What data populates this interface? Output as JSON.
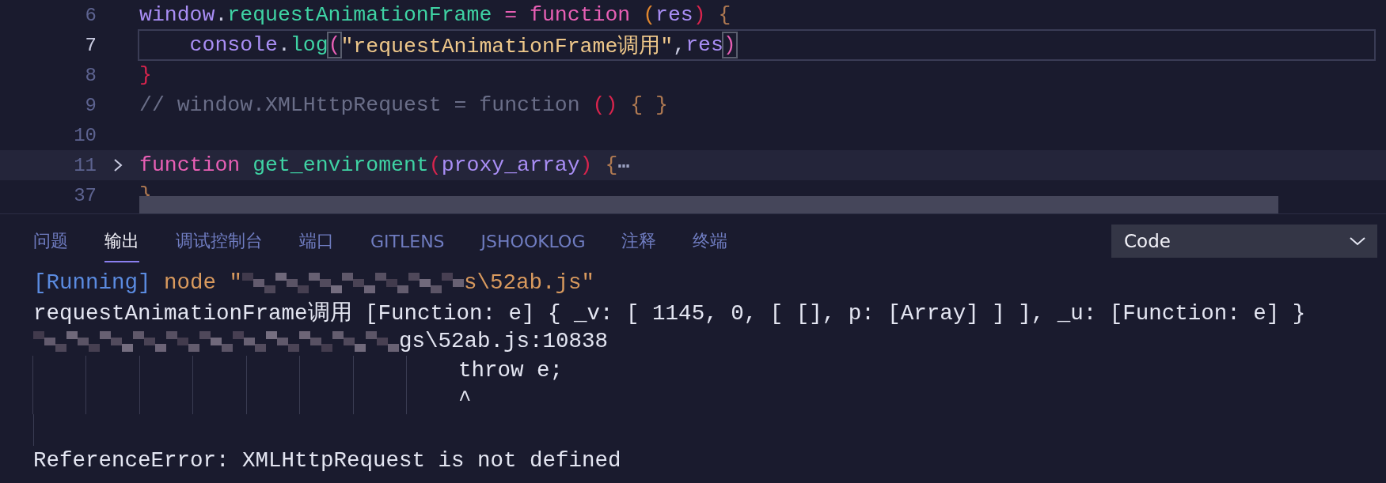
{
  "editor": {
    "lines": [
      {
        "number": "6",
        "current": false,
        "folded": false,
        "tokens": [
          {
            "text": "window",
            "kind": "var"
          },
          {
            "text": ".",
            "kind": "plain"
          },
          {
            "text": "requestAnimationFrame",
            "kind": "prop"
          },
          {
            "text": " = ",
            "kind": "op"
          },
          {
            "text": "function ",
            "kind": "keyword"
          },
          {
            "text": "(",
            "kind": "paren"
          },
          {
            "text": "res",
            "kind": "var"
          },
          {
            "text": ")",
            "kind": "paren2"
          },
          {
            "text": " {",
            "kind": "brace"
          }
        ]
      },
      {
        "number": "7",
        "current": true,
        "folded": false,
        "tokens": [
          {
            "text": "    console",
            "kind": "var"
          },
          {
            "text": ".",
            "kind": "plain"
          },
          {
            "text": "log",
            "kind": "prop"
          },
          {
            "text": "(",
            "kind": "match"
          },
          {
            "text": "\"requestAnimationFrame调用\"",
            "kind": "string"
          },
          {
            "text": ",",
            "kind": "plain"
          },
          {
            "text": "res",
            "kind": "var"
          },
          {
            "text": ")",
            "kind": "match"
          }
        ]
      },
      {
        "number": "8",
        "current": false,
        "folded": false,
        "tokens": [
          {
            "text": "}",
            "kind": "paren2"
          }
        ]
      },
      {
        "number": "9",
        "current": false,
        "folded": false,
        "tokens": [
          {
            "text": "// window.XMLHttpRequest = function ",
            "kind": "comment"
          },
          {
            "text": "()",
            "kind": "paren2"
          },
          {
            "text": " { }",
            "kind": "brace"
          }
        ]
      },
      {
        "number": "10",
        "current": false,
        "folded": false
      },
      {
        "number": "11",
        "current": false,
        "folded": true,
        "tokens": [
          {
            "text": "function ",
            "kind": "keyword"
          },
          {
            "text": "get_enviroment",
            "kind": "prop"
          },
          {
            "text": "(",
            "kind": "paren2"
          },
          {
            "text": "proxy_array",
            "kind": "var"
          },
          {
            "text": ")",
            "kind": "paren2"
          },
          {
            "text": " {",
            "kind": "brace"
          },
          {
            "text": "⋯",
            "kind": "ellipsis"
          }
        ]
      },
      {
        "number": "37",
        "current": false,
        "folded": false,
        "tokens": [
          {
            "text": "}",
            "kind": "brace"
          }
        ]
      }
    ]
  },
  "panel": {
    "tabs": [
      {
        "label": "问题",
        "selected": false
      },
      {
        "label": "输出",
        "selected": true
      },
      {
        "label": "调试控制台",
        "selected": false
      },
      {
        "label": "端口",
        "selected": false
      },
      {
        "label": "GITLENS",
        "selected": false
      },
      {
        "label": "JSHOOKLOG",
        "selected": false
      },
      {
        "label": "注释",
        "selected": false
      },
      {
        "label": "终端",
        "selected": false
      }
    ],
    "channel_select": {
      "value": "Code"
    },
    "output": [
      {
        "kind": "text",
        "segments": [
          {
            "text": "[Running]",
            "kind": "info"
          },
          {
            "text": " node \"",
            "kind": "cmd"
          },
          {
            "kind": "redacted"
          },
          {
            "text": "s\\52ab.js\"",
            "kind": "cmd"
          }
        ]
      },
      {
        "kind": "text",
        "segments": [
          {
            "text": "requestAnimationFrame调用 [Function: e] { _v: [ 1145, 0, [ [], p: [Array] ] ], _u: [Function: e] }",
            "kind": "plain"
          }
        ]
      },
      {
        "kind": "text",
        "segments": [
          {
            "kind": "redacted"
          },
          {
            "text": "gs\\52ab.js:10838",
            "kind": "plain"
          }
        ]
      },
      {
        "kind": "guided",
        "segments": [
          {
            "text": "throw e;",
            "kind": "plain"
          }
        ]
      },
      {
        "kind": "guided",
        "segments": [
          {
            "text": "^",
            "kind": "plain"
          }
        ]
      },
      {
        "kind": "blank"
      },
      {
        "kind": "text",
        "segments": [
          {
            "text": "ReferenceError: XMLHttpRequest is not defined",
            "kind": "plain"
          }
        ]
      }
    ]
  }
}
